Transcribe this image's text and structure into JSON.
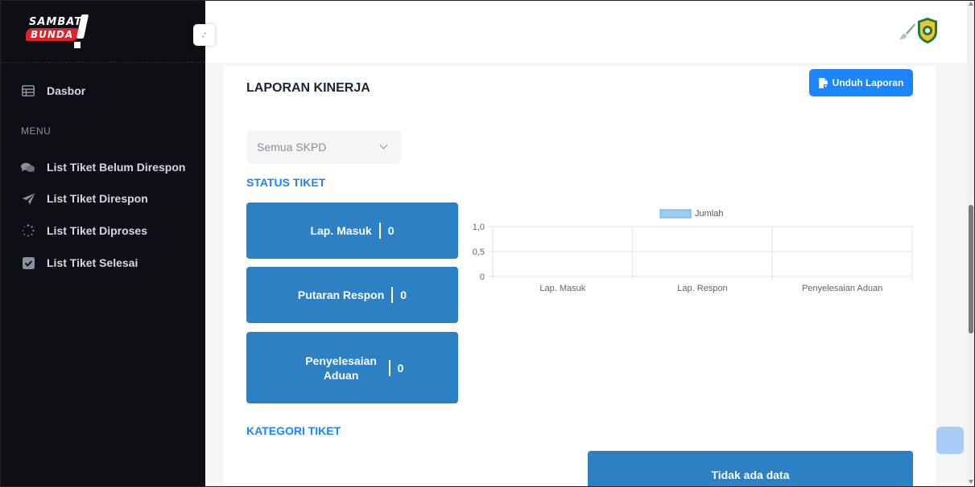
{
  "app": {
    "logo_line1": "SAMBAT",
    "logo_line2": "BUNDA"
  },
  "sidebar": {
    "dashboard": {
      "label": "Dasbor",
      "icon": "table-icon"
    },
    "menu_label": "MENU",
    "items": [
      {
        "label": "List Tiket Belum Direspon",
        "icon": "comments-icon"
      },
      {
        "label": "List Tiket Direspon",
        "icon": "paper-plane-icon"
      },
      {
        "label": "List Tiket Diproses",
        "icon": "spinner-icon"
      },
      {
        "label": "List Tiket Selesai",
        "icon": "checkbox-icon"
      }
    ]
  },
  "page": {
    "title": "LAPORAN KINERJA",
    "download_label": "Unduh Laporan",
    "filter": {
      "selected": "Semua SKPD"
    },
    "status_section": "STATUS TIKET",
    "category_section": "KATEGORI TIKET",
    "no_data": "Tidak ada data"
  },
  "stats": [
    {
      "label": "Lap. Masuk",
      "value": "0"
    },
    {
      "label": "Putaran Respon",
      "value": "0"
    },
    {
      "label": "Penyelesaian Aduan",
      "value": "0"
    }
  ],
  "colors": {
    "sidebar_bg": "#0d0f14",
    "accent": "#1b84ff",
    "stat_card": "#2d81c3",
    "legend_swatch": "#9ccbf0"
  },
  "chart_data": {
    "type": "bar",
    "categories": [
      "Lap. Masuk",
      "Lap. Respon",
      "Penyelesaian Aduan"
    ],
    "series": [
      {
        "name": "Jumlah",
        "values": [
          0,
          0,
          0
        ]
      }
    ],
    "yticks": [
      "0",
      "0,5",
      "1,0"
    ],
    "ylim": [
      0,
      1
    ],
    "legend": "top",
    "grid": true
  }
}
